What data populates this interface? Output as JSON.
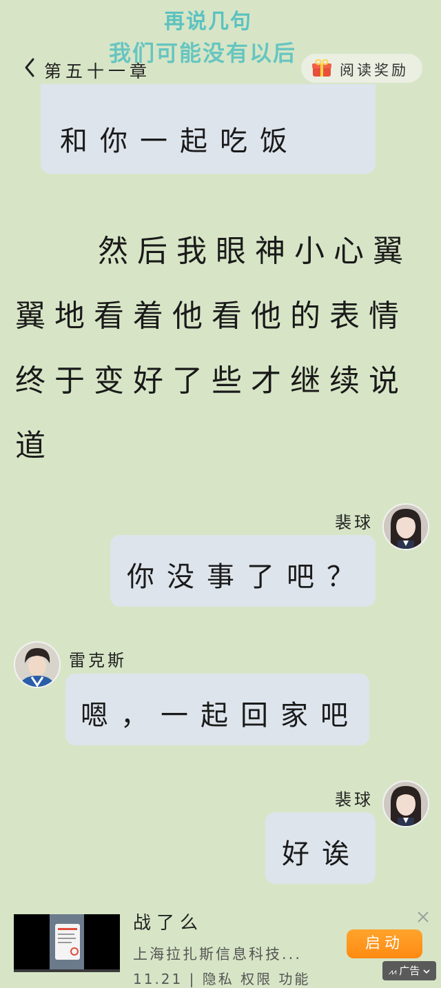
{
  "watermark": {
    "line1": "再说几句",
    "line2": "我们可能没有以后"
  },
  "header": {
    "chapter_title": "第五十一章",
    "reward_label": "阅读奖励"
  },
  "messages": {
    "top_partial": "和你一起吃饭",
    "paragraph_lines": [
      "然后我眼神小心翼",
      "翼地看着他看他的表情",
      "终于变好了些才继续说",
      "道"
    ],
    "msg1": {
      "name": "裴球",
      "text": "你没事了吧？"
    },
    "msg2": {
      "name": "雷克斯",
      "text": "嗯，一起回家吧"
    },
    "msg3": {
      "name": "裴球",
      "text": "好诶"
    }
  },
  "ad": {
    "title": "战了么",
    "company": "上海拉扎斯信息科技...",
    "meta": "11.21 | 隐私 权限 功能",
    "button": "启动",
    "badge": "广告"
  },
  "colors": {
    "background": "#d7e5c6",
    "bubble": "#dde4ec",
    "watermark": "#5bc2c0",
    "ad_button": "#ff8a12"
  }
}
